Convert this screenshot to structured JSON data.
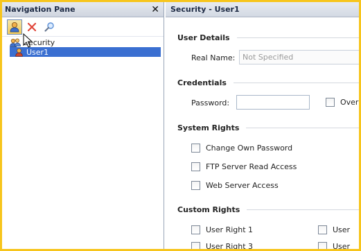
{
  "nav": {
    "title": "Navigation Pane",
    "close_symbol": "✕",
    "toolbar": [
      {
        "icon": "user-icon",
        "active": true
      },
      {
        "icon": "delete-icon",
        "active": false
      },
      {
        "icon": "search-icon",
        "active": false
      }
    ],
    "tree": {
      "root_label": "Security",
      "child_label": "User1"
    }
  },
  "content": {
    "title": "Security - User1",
    "sections": {
      "user_details": {
        "heading": "User Details",
        "real_name_label": "Real Name:",
        "real_name_placeholder": "Not Specified"
      },
      "credentials": {
        "heading": "Credentials",
        "password_label": "Password:",
        "password_value": "",
        "override_label": "Overr"
      },
      "system_rights": {
        "heading": "System Rights",
        "items": [
          "Change Own Password",
          "FTP Server Read Access",
          "Web Server Access"
        ]
      },
      "custom_rights": {
        "heading": "Custom Rights",
        "items": [
          "User Right 1",
          "User",
          "User Right 3",
          "User"
        ]
      }
    }
  },
  "colors": {
    "frame": "#f7c51c",
    "selection": "#3a6fd1"
  }
}
